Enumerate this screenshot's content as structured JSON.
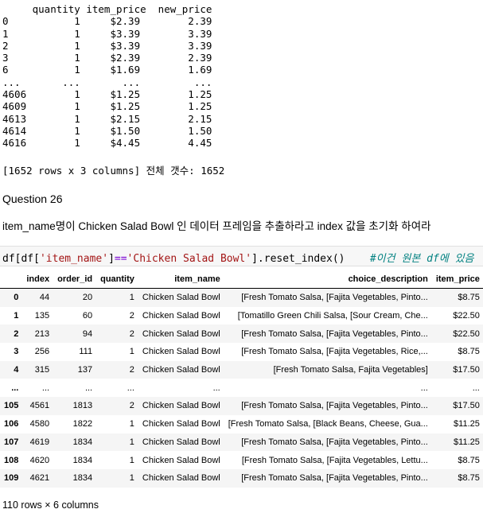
{
  "output1": {
    "lines": [
      "     quantity item_price  new_price",
      "0           1     $2.39        2.39",
      "1           1     $3.39        3.39",
      "2           1     $3.39        3.39",
      "3           1     $2.39        2.39",
      "6           1     $1.69        1.69",
      "...       ...       ...         ...",
      "4606        1     $1.25        1.25",
      "4609        1     $1.25        1.25",
      "4613        1     $2.15        2.15",
      "4614        1     $1.50        1.50",
      "4616        1     $4.45        4.45"
    ],
    "summary": "[1652 rows x 3 columns] 전체 갯수: 1652"
  },
  "question": {
    "title": "Question 26",
    "description": "item_name명이 Chicken Salad Bowl 인 데이터 프레임을 추출하라고 index 값을 초기화 하여라"
  },
  "code": {
    "part1": "df[df[",
    "str1": "'item_name'",
    "part2": "]",
    "op": "==",
    "str2": "'Chicken Salad Bowl'",
    "part3": "].reset_index()",
    "comment": "#이건 원본 df에 있음"
  },
  "table": {
    "headers": [
      "",
      "index",
      "order_id",
      "quantity",
      "item_name",
      "choice_description",
      "item_price"
    ],
    "rows": [
      [
        "0",
        "44",
        "20",
        "1",
        "Chicken Salad Bowl",
        "[Fresh Tomato Salsa, [Fajita Vegetables, Pinto...",
        "$8.75"
      ],
      [
        "1",
        "135",
        "60",
        "2",
        "Chicken Salad Bowl",
        "[Tomatillo Green Chili Salsa, [Sour Cream, Che...",
        "$22.50"
      ],
      [
        "2",
        "213",
        "94",
        "2",
        "Chicken Salad Bowl",
        "[Fresh Tomato Salsa, [Fajita Vegetables, Pinto...",
        "$22.50"
      ],
      [
        "3",
        "256",
        "111",
        "1",
        "Chicken Salad Bowl",
        "[Fresh Tomato Salsa, [Fajita Vegetables, Rice,...",
        "$8.75"
      ],
      [
        "4",
        "315",
        "137",
        "2",
        "Chicken Salad Bowl",
        "[Fresh Tomato Salsa, Fajita Vegetables]",
        "$17.50"
      ],
      [
        "...",
        "...",
        "...",
        "...",
        "...",
        "...",
        "..."
      ],
      [
        "105",
        "4561",
        "1813",
        "2",
        "Chicken Salad Bowl",
        "[Fresh Tomato Salsa, [Fajita Vegetables, Pinto...",
        "$17.50"
      ],
      [
        "106",
        "4580",
        "1822",
        "1",
        "Chicken Salad Bowl",
        "[Fresh Tomato Salsa, [Black Beans, Cheese, Gua...",
        "$11.25"
      ],
      [
        "107",
        "4619",
        "1834",
        "1",
        "Chicken Salad Bowl",
        "[Fresh Tomato Salsa, [Fajita Vegetables, Pinto...",
        "$11.25"
      ],
      [
        "108",
        "4620",
        "1834",
        "1",
        "Chicken Salad Bowl",
        "[Fresh Tomato Salsa, [Fajita Vegetables, Lettu...",
        "$8.75"
      ],
      [
        "109",
        "4621",
        "1834",
        "1",
        "Chicken Salad Bowl",
        "[Fresh Tomato Salsa, [Fajita Vegetables, Pinto...",
        "$8.75"
      ]
    ],
    "footer": "110 rows × 6 columns"
  }
}
